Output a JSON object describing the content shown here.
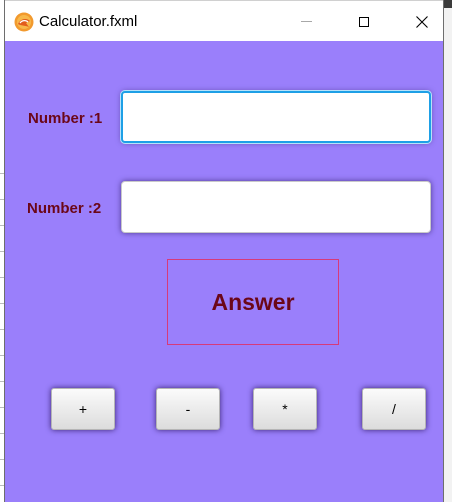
{
  "window": {
    "title": "Calculator.fxml",
    "app_icon": "javafx-icon"
  },
  "form": {
    "number1_label": "Number :1",
    "number1_value": "",
    "number2_label": "Number :2",
    "number2_value": "",
    "answer_text": "Answer"
  },
  "operations": {
    "add": "+",
    "subtract": "-",
    "multiply": "*",
    "divide": "/"
  },
  "colors": {
    "background": "#9a7ffb",
    "label": "#6b0718",
    "answer_border": "#d63a7a",
    "focus": "#1ea0e6"
  }
}
